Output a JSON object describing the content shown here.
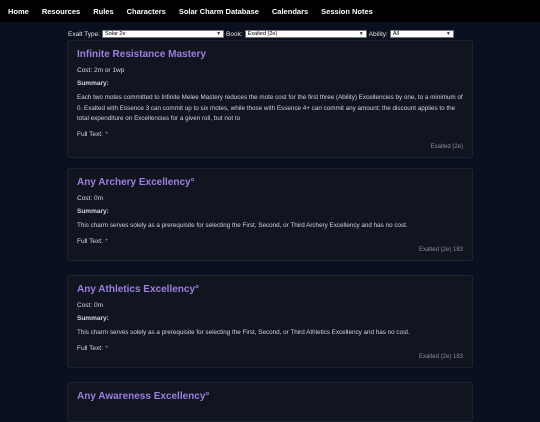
{
  "nav": {
    "items": [
      "Home",
      "Resources",
      "Rules",
      "Characters",
      "Solar Charm Database",
      "Calendars",
      "Session Notes"
    ]
  },
  "filters": {
    "exalt_label": "Exalt Type:",
    "exalt_value": "Solar 2e",
    "book_label": "Book:",
    "book_value": "Exalted (2e)",
    "ability_label": "Ability:",
    "ability_value": "All"
  },
  "charms": [
    {
      "title": "Infinite Resistance Mastery",
      "cost_label": "Cost:",
      "cost": "2m or 1wp",
      "summary_label": "Summary:",
      "summary": "Each two motes committed to Infinite Melee Mastery reduces the mote cost for the first three (Ability) Excellencies by one, to a minimum of 0. Exalted with Essence 3 can commit up to six motes, while those with Essence 4+ can commit any amount; the discount applies to the total expenditure on Excellencies for a given roll, but not to",
      "fulltext_label": "Full Text:",
      "fulltext_toggle": "+",
      "source": "Exalted (2e)"
    },
    {
      "title": "Any Archery Excellency°",
      "cost_label": "Cost:",
      "cost": "0m",
      "summary_label": "Summary:",
      "summary": "This charm serves solely as a prerequisite for selecting the First, Second, or Third Archery Excellency and has no cost.",
      "fulltext_label": "Full Text:",
      "fulltext_toggle": "+",
      "source": "Exalted (2e) 183"
    },
    {
      "title": "Any Athletics Excellency°",
      "cost_label": "Cost:",
      "cost": "0m",
      "summary_label": "Summary:",
      "summary": "This charm serves solely as a prerequisite for selecting the First, Second, or Third Athletics Excellency and has no cost.",
      "fulltext_label": "Full Text:",
      "fulltext_toggle": "+",
      "source": "Exalted (2e) 183"
    },
    {
      "title": "Any Awareness Excellency°"
    }
  ]
}
